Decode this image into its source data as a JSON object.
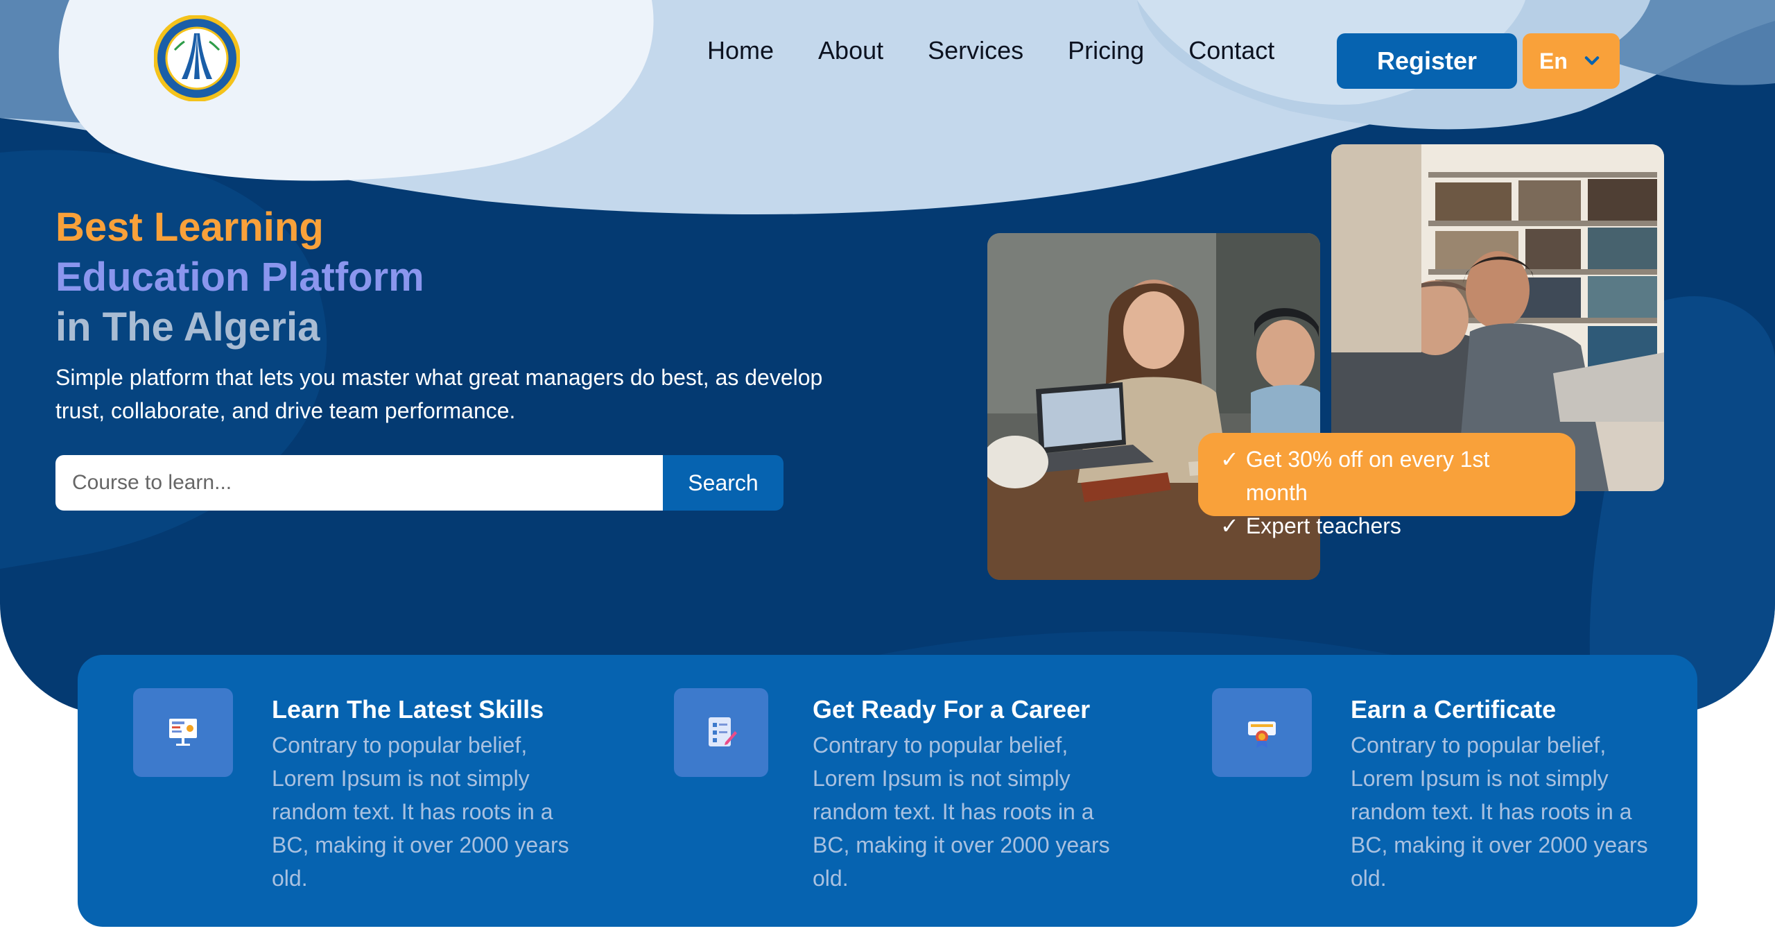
{
  "header": {
    "logo_alt": "Chambre de Commerce et d'Industrie",
    "nav": [
      {
        "label": "Home"
      },
      {
        "label": "About"
      },
      {
        "label": "Services"
      },
      {
        "label": "Pricing"
      },
      {
        "label": "Contact"
      }
    ],
    "register_label": "Register",
    "language": "En"
  },
  "hero": {
    "headline_1": "Best Learning",
    "headline_2": "Education Platform",
    "headline_3": "in The Algeria",
    "subtitle": "Simple platform that lets you master what great managers do best, as develop trust, collaborate, and drive team performance.",
    "search_placeholder": "Course to learn...",
    "search_button": "Search",
    "promo": [
      {
        "check": "✓",
        "text": "Get 30% off on every 1st month"
      },
      {
        "check": "✓",
        "text": "Expert teachers"
      }
    ]
  },
  "features": [
    {
      "title": "Learn The Latest Skills",
      "desc": "Contrary to popular belief, Lorem Ipsum is not simply random text. It has roots in a BC, making it over 2000 years old.",
      "icon": "presentation-board-icon"
    },
    {
      "title": "Get Ready For a Career",
      "desc": "Contrary to popular belief, Lorem Ipsum is not simply random text. It has roots in a BC, making it over 2000 years old.",
      "icon": "checklist-document-icon"
    },
    {
      "title": "Earn a Certificate",
      "desc": "Contrary to popular belief, Lorem Ipsum is not simply random text. It has roots in a BC, making it over 2000 years old.",
      "icon": "certificate-icon"
    }
  ],
  "colors": {
    "hero_bg": "#043a72",
    "primary_blue": "#0663b0",
    "accent_orange": "#f9a13a",
    "headline_purple": "#8b96ee",
    "headline_gray": "#a9bcd3"
  }
}
